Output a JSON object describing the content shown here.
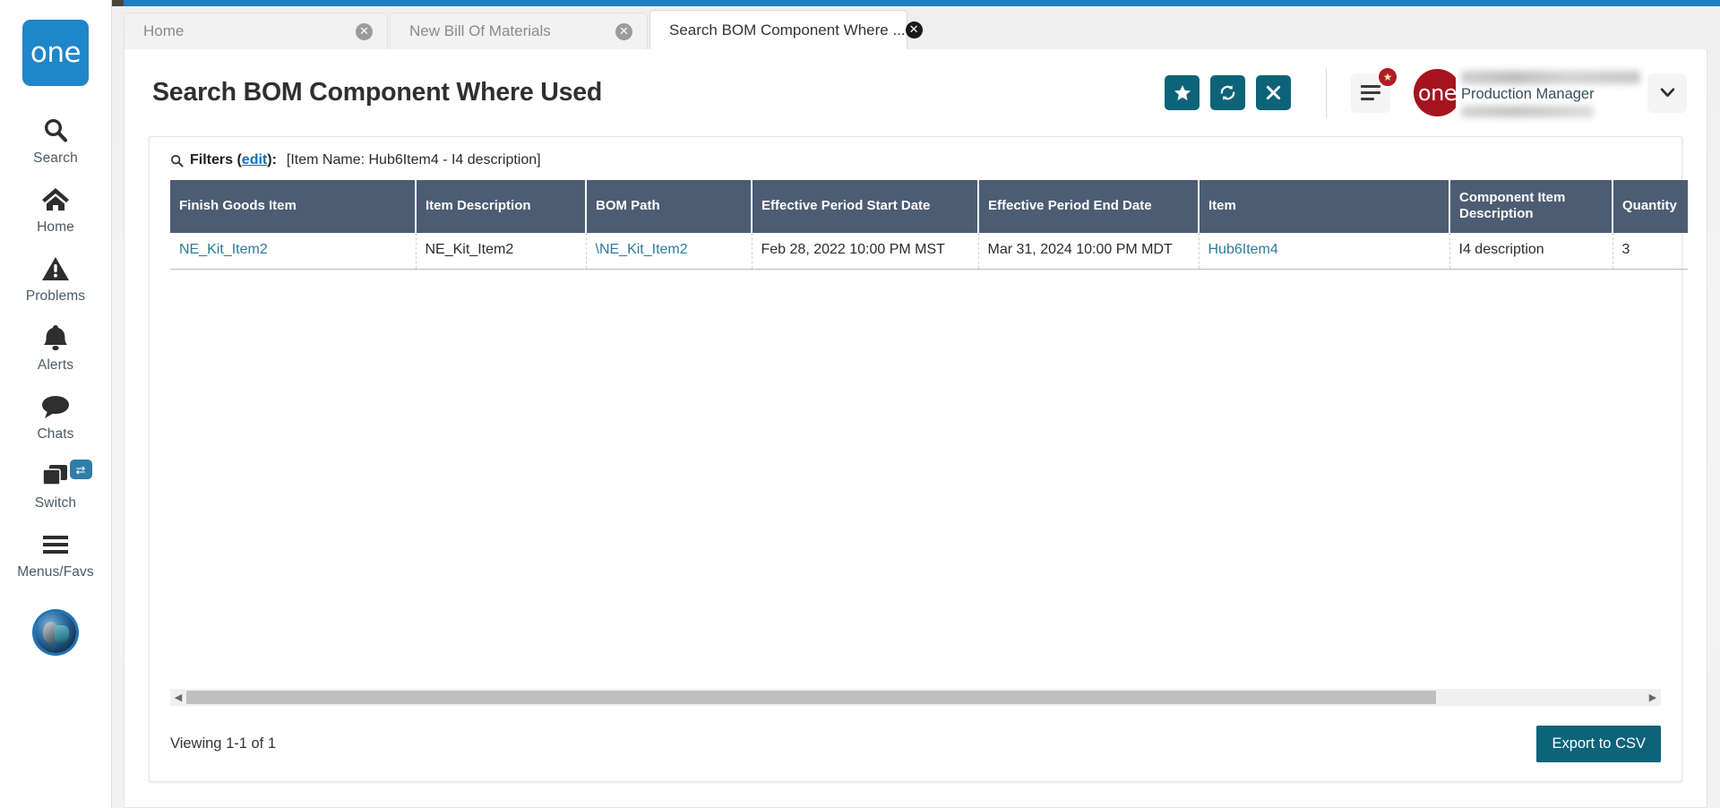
{
  "sidebar": {
    "logo_text": "one",
    "items": [
      {
        "label": "Search",
        "icon": "search-icon"
      },
      {
        "label": "Home",
        "icon": "home-icon"
      },
      {
        "label": "Problems",
        "icon": "warning-triangle-icon"
      },
      {
        "label": "Alerts",
        "icon": "bell-icon"
      },
      {
        "label": "Chats",
        "icon": "speech-bubble-icon"
      },
      {
        "label": "Switch",
        "icon": "switch-windows-icon",
        "badge_icon": "swap-arrows-icon"
      },
      {
        "label": "Menus/Favs",
        "icon": "hamburger-icon"
      }
    ],
    "avatar_icon": "user-avatar"
  },
  "tabs": [
    {
      "label": "Home",
      "active": false,
      "close_icon": "close-circle-icon"
    },
    {
      "label": "New Bill Of Materials",
      "active": false,
      "close_icon": "close-circle-icon"
    },
    {
      "label": "Search BOM Component Where ...",
      "active": true,
      "close_icon": "close-circle-icon"
    }
  ],
  "header": {
    "title": "Search BOM Component Where Used",
    "actions": [
      {
        "name": "favorite-button",
        "icon": "star-icon"
      },
      {
        "name": "refresh-button",
        "icon": "refresh-icon"
      },
      {
        "name": "close-button",
        "icon": "x-icon"
      }
    ],
    "menu_icon": "hamburger-menu-icon",
    "menu_badge_icon": "star-badge-icon",
    "brand_text": "one",
    "user_role": "Production Manager",
    "caret_icon": "chevron-down-icon"
  },
  "filters": {
    "icon": "magnifier-icon",
    "label": "Filters (",
    "edit_label": "edit",
    "label_end": "):",
    "value": "[Item Name: Hub6Item4 - I4 description]"
  },
  "table": {
    "columns": [
      "Finish Goods Item",
      "Item Description",
      "BOM Path",
      "Effective Period Start Date",
      "Effective Period End Date",
      "Item",
      "Component Item Description",
      "Quantity"
    ],
    "rows": [
      {
        "finish_goods_item": "NE_Kit_Item2",
        "item_description": "NE_Kit_Item2",
        "bom_path": "\\NE_Kit_Item2",
        "effective_period_start_date": "Feb 28, 2022 10:00 PM MST",
        "effective_period_end_date": "Mar 31, 2024 10:00 PM MDT",
        "item": "Hub6Item4",
        "component_item_description": "I4 description",
        "quantity": "3"
      }
    ]
  },
  "scrollbar": {
    "left_arrow_icon": "triangle-left-icon",
    "right_arrow_icon": "triangle-right-icon"
  },
  "footer": {
    "viewing_text": "Viewing 1-1 of 1",
    "export_label": "Export to CSV"
  },
  "colors": {
    "accent_teal": "#0d6378",
    "brand_red": "#a5131e",
    "logo_blue": "#1f86c9",
    "topbar_blue": "#1f7ec2",
    "table_header": "#4c5c73",
    "link": "#2c7b9b"
  }
}
